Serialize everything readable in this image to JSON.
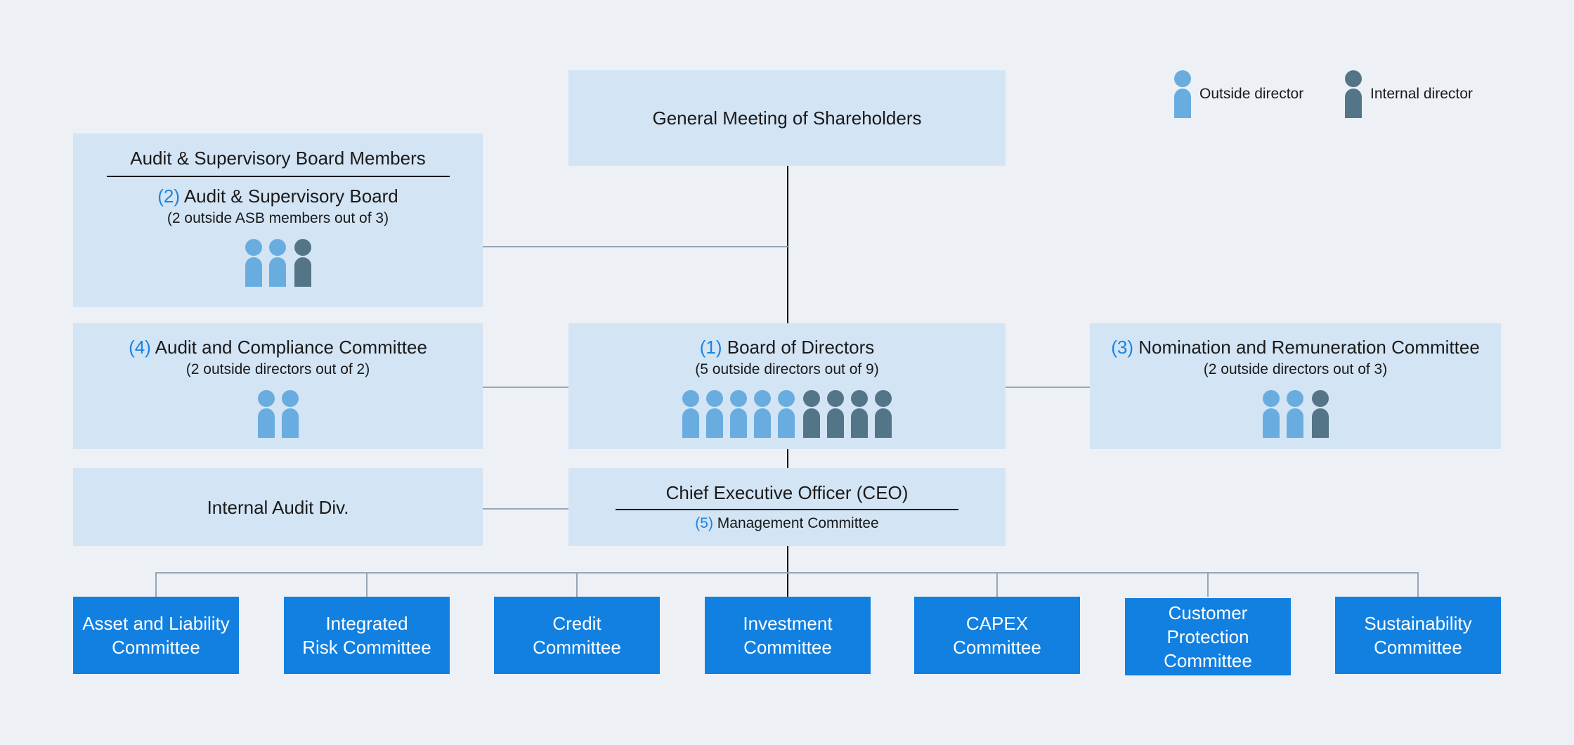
{
  "colors": {
    "outside": "#69ade0",
    "internal": "#547587",
    "accent": "#1a84e0",
    "box": "#d3e4f4",
    "committee": "#1180e1",
    "background": "#edf1f5"
  },
  "legend": {
    "outside": "Outside director",
    "internal": "Internal director"
  },
  "shareholders": {
    "title": "General Meeting of Shareholders"
  },
  "asb": {
    "header": "Audit & Supervisory Board Members",
    "num": "(2)",
    "title": "Audit & Supervisory Board",
    "sub": "(2 outside ASB members out of 3)",
    "outside": 2,
    "internal": 1
  },
  "acc": {
    "num": "(4)",
    "title": "Audit and Compliance Committee",
    "sub": "(2 outside directors out of 2)",
    "outside": 2,
    "internal": 0
  },
  "board": {
    "num": "(1)",
    "title": "Board of Directors",
    "sub": "(5 outside directors out of 9)",
    "outside": 5,
    "internal": 4
  },
  "nrc": {
    "num": "(3)",
    "title": "Nomination and Remuneration Committee",
    "sub": "(2 outside directors out of 3)",
    "outside": 2,
    "internal": 1
  },
  "internal_audit": {
    "title": "Internal Audit Div."
  },
  "ceo": {
    "title": "Chief Executive Officer (CEO)",
    "num": "(5)",
    "sub": "Management Committee"
  },
  "committees": [
    "Asset and Liability\nCommittee",
    "Integrated\nRisk Committee",
    "Credit\nCommittee",
    "Investment\nCommittee",
    "CAPEX\nCommittee",
    "Customer\nProtection\nCommittee",
    "Sustainability\nCommittee"
  ]
}
